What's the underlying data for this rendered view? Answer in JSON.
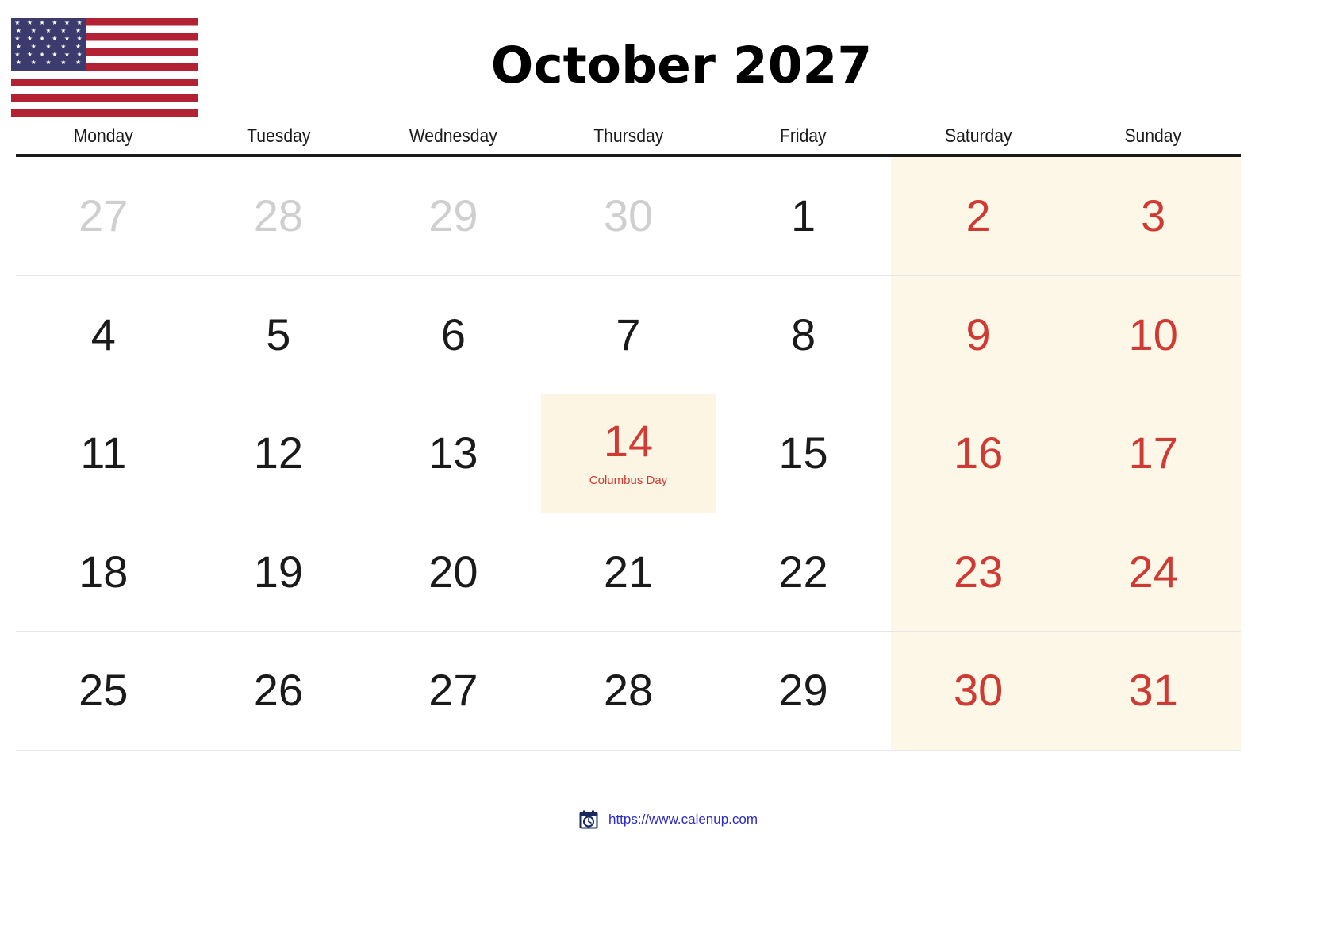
{
  "header": {
    "flag_alt": "united-states-flag",
    "title": "October 2027"
  },
  "calendar": {
    "weekdays": [
      "Monday",
      "Tuesday",
      "Wednesday",
      "Thursday",
      "Friday",
      "Saturday",
      "Sunday"
    ],
    "colors": {
      "weekend_bg": "#FDF7E8",
      "holiday_bg": "#FDF5E4",
      "weekend_text": "#CF3A34",
      "holiday_text": "#CF3A34",
      "other_month_text": "#CFCFCF",
      "day_text": "#1A1A1A",
      "header_rule": "#1A1A1A",
      "row_rule": "#E6E6E6",
      "link": "#2B2BC8"
    },
    "weeks": [
      [
        {
          "day": "27",
          "type": "other"
        },
        {
          "day": "28",
          "type": "other"
        },
        {
          "day": "29",
          "type": "other"
        },
        {
          "day": "30",
          "type": "other"
        },
        {
          "day": "1",
          "type": "normal"
        },
        {
          "day": "2",
          "type": "weekend"
        },
        {
          "day": "3",
          "type": "weekend"
        }
      ],
      [
        {
          "day": "4",
          "type": "normal"
        },
        {
          "day": "5",
          "type": "normal"
        },
        {
          "day": "6",
          "type": "normal"
        },
        {
          "day": "7",
          "type": "normal"
        },
        {
          "day": "8",
          "type": "normal"
        },
        {
          "day": "9",
          "type": "weekend"
        },
        {
          "day": "10",
          "type": "weekend"
        }
      ],
      [
        {
          "day": "11",
          "type": "normal"
        },
        {
          "day": "12",
          "type": "normal"
        },
        {
          "day": "13",
          "type": "normal"
        },
        {
          "day": "14",
          "type": "holiday",
          "event": "Columbus Day"
        },
        {
          "day": "15",
          "type": "normal"
        },
        {
          "day": "16",
          "type": "weekend"
        },
        {
          "day": "17",
          "type": "weekend"
        }
      ],
      [
        {
          "day": "18",
          "type": "normal"
        },
        {
          "day": "19",
          "type": "normal"
        },
        {
          "day": "20",
          "type": "normal"
        },
        {
          "day": "21",
          "type": "normal"
        },
        {
          "day": "22",
          "type": "normal"
        },
        {
          "day": "23",
          "type": "weekend"
        },
        {
          "day": "24",
          "type": "weekend"
        }
      ],
      [
        {
          "day": "25",
          "type": "normal"
        },
        {
          "day": "26",
          "type": "normal"
        },
        {
          "day": "27",
          "type": "normal"
        },
        {
          "day": "28",
          "type": "normal"
        },
        {
          "day": "29",
          "type": "normal"
        },
        {
          "day": "30",
          "type": "weekend"
        },
        {
          "day": "31",
          "type": "weekend"
        }
      ]
    ]
  },
  "footer": {
    "icon": "calendar-clock-icon",
    "link_text": "https://www.calenup.com"
  }
}
